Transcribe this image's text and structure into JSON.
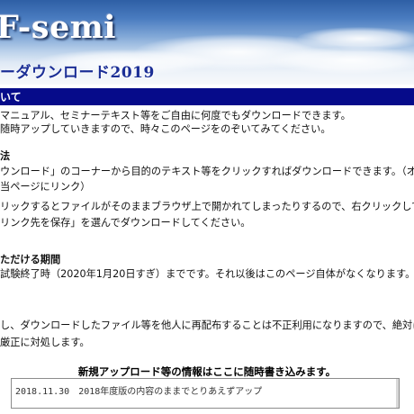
{
  "header": {
    "logo_text": "F-semi",
    "subtitle": "ーダウンロード2019"
  },
  "section": {
    "title": "いて"
  },
  "body": {
    "intro": [
      "マニュアル、セミナーテキスト等をご自由に何度でもダウンロードできます。",
      "随時アップしていきますので、時々このページをのぞいてみてください。"
    ],
    "method_heading": "法",
    "method": [
      "ウンロード」のコーナーから目的のテキスト等をクリックすればダウンロードできます。（オンライン",
      "当ページにリンク）",
      "リックするとファイルがそのままブラウザ上で開かれてしまったりするので、右クリックして「対象を",
      "リンク先を保存」を選んでダウンロードしてください。"
    ],
    "period_heading": "ただける期間",
    "period": "試験終了時（2020年1月20日すぎ）までです。それ以後はこのページ自体がなくなります。",
    "warning": [
      "し、ダウンロードしたファイル等を他人に再配布することは不正利用になりますので、絶対にしないで",
      "厳正に対処します。"
    ]
  },
  "updates": {
    "title": "新規アップロード等の情報はここに随時書き込みます。",
    "entries": "2018.11.30　2018年度版の内容のままでとりあえずアップ"
  }
}
